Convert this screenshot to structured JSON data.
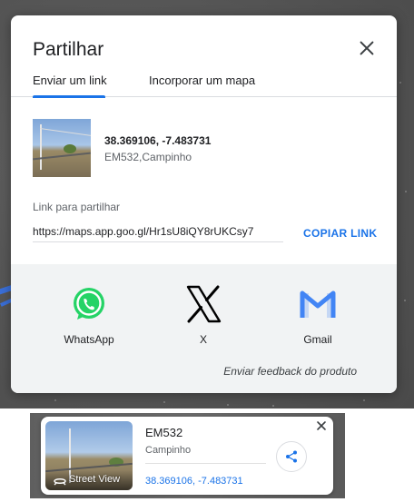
{
  "dialog": {
    "title": "Partilhar",
    "tabs": [
      {
        "label": "Enviar um link",
        "active": true
      },
      {
        "label": "Incorporar um mapa",
        "active": false
      }
    ],
    "place": {
      "coordinates": "38.369106, -7.483731",
      "address": "EM532,Campinho"
    },
    "link": {
      "label": "Link para partilhar",
      "value": "https://maps.app.goo.gl/Hr1sU8iQY8rUKCsy7",
      "copy_label": "COPIAR LINK"
    },
    "share_options": [
      {
        "label": "WhatsApp",
        "icon": "whatsapp-icon"
      },
      {
        "label": "X",
        "icon": "x-icon"
      },
      {
        "label": "Gmail",
        "icon": "gmail-icon"
      }
    ],
    "feedback": "Enviar feedback do produto"
  },
  "mini_card": {
    "title": "EM532",
    "subtitle": "Campinho",
    "coordinates": "38.369106, -7.483731",
    "street_view_label": "Street View"
  },
  "colors": {
    "accent": "#1a73e8",
    "whatsapp": "#25d366",
    "gmail_blue": "#4285f4",
    "panel_bg": "#f1f3f4"
  }
}
